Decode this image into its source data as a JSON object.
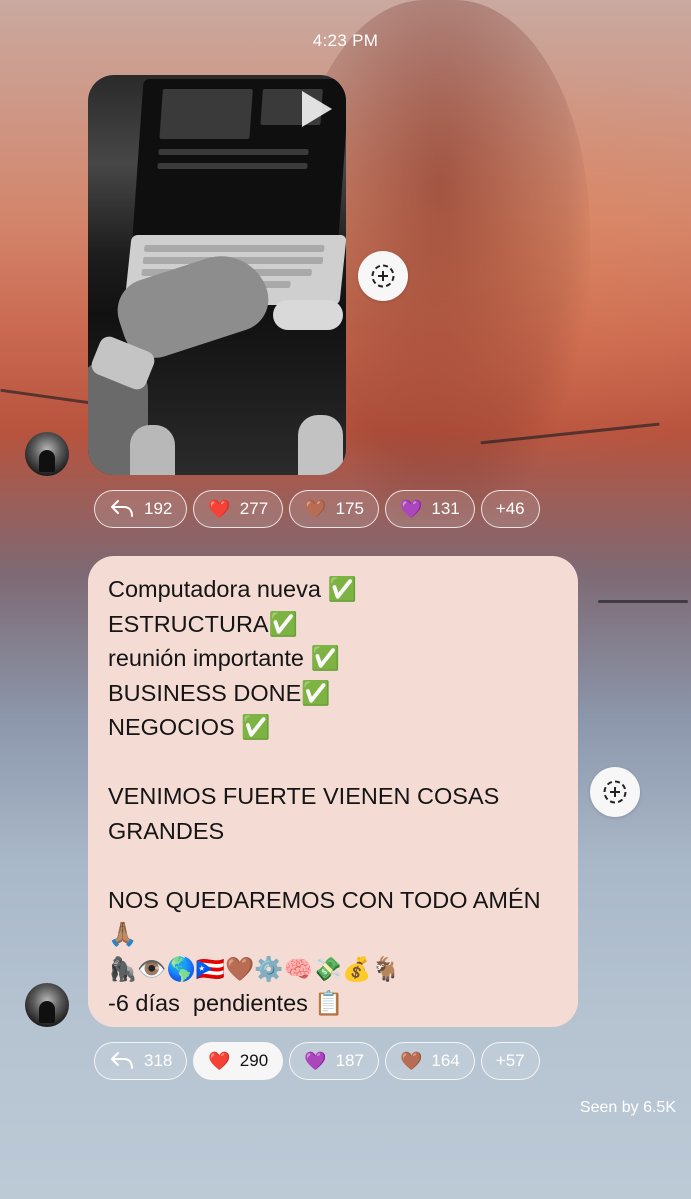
{
  "status": {
    "time": "4:23 PM"
  },
  "photo_message": {
    "media_type": "video",
    "play_icon": "play-icon",
    "reactions": [
      {
        "icon": "reply-icon",
        "emoji": "",
        "count": "192",
        "active": false
      },
      {
        "icon": "",
        "emoji": "❤️",
        "count": "277",
        "active": false
      },
      {
        "icon": "",
        "emoji": "🤎",
        "count": "175",
        "active": false
      },
      {
        "icon": "",
        "emoji": "💜",
        "count": "131",
        "active": false
      },
      {
        "icon": "",
        "emoji": "",
        "count": "+46",
        "active": false
      }
    ]
  },
  "text_message": {
    "lines": [
      "Computadora nueva ✅",
      "ESTRUCTURA✅",
      "reunión importante ✅",
      "BUSINESS DONE✅",
      "NEGOCIOS ✅",
      "",
      "VENIMOS FUERTE VIENEN COSAS",
      "GRANDES",
      "",
      "NOS QUEDAREMOS CON TODO AMÉN",
      "🙏🏽",
      "🦍👁️🌎🇵🇷🤎⚙️🧠💸💰🐐",
      "-6 días  pendientes 📋"
    ],
    "reactions": [
      {
        "icon": "reply-icon",
        "emoji": "",
        "count": "318",
        "active": false
      },
      {
        "icon": "",
        "emoji": "❤️",
        "count": "290",
        "active": true
      },
      {
        "icon": "",
        "emoji": "💜",
        "count": "187",
        "active": false
      },
      {
        "icon": "",
        "emoji": "🤎",
        "count": "164",
        "active": false
      },
      {
        "icon": "",
        "emoji": "",
        "count": "+57",
        "active": false
      }
    ]
  },
  "footer": {
    "seen": "Seen by 6.5K"
  },
  "colors": {
    "bubble": "#f4dcd5",
    "pill_border": "#ffffff",
    "active_pill": "#f6f6f6"
  }
}
